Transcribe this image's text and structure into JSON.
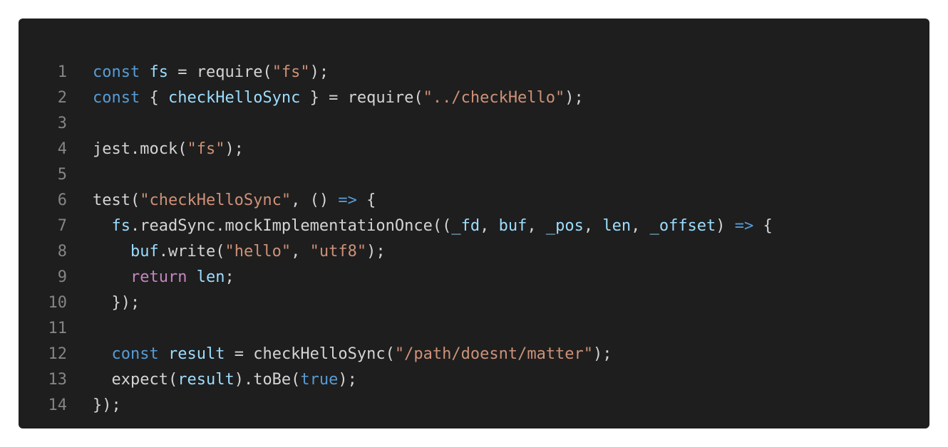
{
  "editor": {
    "background": "#1e1e1e",
    "lines": [
      {
        "number": "1",
        "tokens": [
          {
            "t": "const",
            "c": "kw"
          },
          {
            "t": " ",
            "c": "plain"
          },
          {
            "t": "fs",
            "c": "var"
          },
          {
            "t": " = require(",
            "c": "plain"
          },
          {
            "t": "\"fs\"",
            "c": "str"
          },
          {
            "t": ");",
            "c": "plain"
          }
        ]
      },
      {
        "number": "2",
        "tokens": [
          {
            "t": "const",
            "c": "kw"
          },
          {
            "t": " { ",
            "c": "plain"
          },
          {
            "t": "checkHelloSync",
            "c": "var"
          },
          {
            "t": " } = require(",
            "c": "plain"
          },
          {
            "t": "\"../checkHello\"",
            "c": "str"
          },
          {
            "t": ");",
            "c": "plain"
          }
        ]
      },
      {
        "number": "3",
        "tokens": []
      },
      {
        "number": "4",
        "tokens": [
          {
            "t": "jest.mock(",
            "c": "plain"
          },
          {
            "t": "\"fs\"",
            "c": "str"
          },
          {
            "t": ");",
            "c": "plain"
          }
        ]
      },
      {
        "number": "5",
        "tokens": []
      },
      {
        "number": "6",
        "tokens": [
          {
            "t": "test(",
            "c": "plain"
          },
          {
            "t": "\"checkHelloSync\"",
            "c": "str"
          },
          {
            "t": ", () ",
            "c": "plain"
          },
          {
            "t": "=>",
            "c": "kw"
          },
          {
            "t": " {",
            "c": "plain"
          }
        ]
      },
      {
        "number": "7",
        "tokens": [
          {
            "t": "  ",
            "c": "plain"
          },
          {
            "t": "fs",
            "c": "var"
          },
          {
            "t": ".readSync.mockImplementationOnce((",
            "c": "plain"
          },
          {
            "t": "_fd",
            "c": "var"
          },
          {
            "t": ", ",
            "c": "plain"
          },
          {
            "t": "buf",
            "c": "var"
          },
          {
            "t": ", ",
            "c": "plain"
          },
          {
            "t": "_pos",
            "c": "var"
          },
          {
            "t": ", ",
            "c": "plain"
          },
          {
            "t": "len",
            "c": "var"
          },
          {
            "t": ", ",
            "c": "plain"
          },
          {
            "t": "_offset",
            "c": "var"
          },
          {
            "t": ") ",
            "c": "plain"
          },
          {
            "t": "=>",
            "c": "kw"
          },
          {
            "t": " {",
            "c": "plain"
          }
        ]
      },
      {
        "number": "8",
        "tokens": [
          {
            "t": "    ",
            "c": "plain"
          },
          {
            "t": "buf",
            "c": "var"
          },
          {
            "t": ".write(",
            "c": "plain"
          },
          {
            "t": "\"hello\"",
            "c": "str"
          },
          {
            "t": ", ",
            "c": "plain"
          },
          {
            "t": "\"utf8\"",
            "c": "str"
          },
          {
            "t": ");",
            "c": "plain"
          }
        ]
      },
      {
        "number": "9",
        "tokens": [
          {
            "t": "    ",
            "c": "plain"
          },
          {
            "t": "return",
            "c": "ctrl"
          },
          {
            "t": " ",
            "c": "plain"
          },
          {
            "t": "len",
            "c": "var"
          },
          {
            "t": ";",
            "c": "plain"
          }
        ]
      },
      {
        "number": "10",
        "tokens": [
          {
            "t": "  });",
            "c": "plain"
          }
        ]
      },
      {
        "number": "11",
        "tokens": []
      },
      {
        "number": "12",
        "tokens": [
          {
            "t": "  ",
            "c": "plain"
          },
          {
            "t": "const",
            "c": "kw"
          },
          {
            "t": " ",
            "c": "plain"
          },
          {
            "t": "result",
            "c": "var"
          },
          {
            "t": " = checkHelloSync(",
            "c": "plain"
          },
          {
            "t": "\"/path/doesnt/matter\"",
            "c": "str"
          },
          {
            "t": ");",
            "c": "plain"
          }
        ]
      },
      {
        "number": "13",
        "tokens": [
          {
            "t": "  expect(",
            "c": "plain"
          },
          {
            "t": "result",
            "c": "var"
          },
          {
            "t": ").toBe(",
            "c": "plain"
          },
          {
            "t": "true",
            "c": "kw"
          },
          {
            "t": ");",
            "c": "plain"
          }
        ]
      },
      {
        "number": "14",
        "tokens": [
          {
            "t": "});",
            "c": "plain"
          }
        ]
      }
    ]
  }
}
